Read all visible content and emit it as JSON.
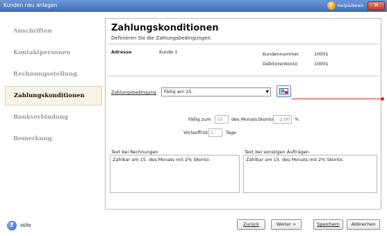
{
  "window": {
    "title": "Kunden neu anlegen",
    "help_label": "Help&News",
    "close_glyph": "✕"
  },
  "sidebar": {
    "items": [
      {
        "label": "Anschriften"
      },
      {
        "label": "Kontaktpersonen"
      },
      {
        "label": "Rechnungsstellung"
      },
      {
        "label": "Zahlungskonditionen"
      },
      {
        "label": "Bankverbindung"
      },
      {
        "label": "Bemerkung"
      }
    ],
    "active_index": 3
  },
  "header": {
    "title": "Zahlungskonditionen",
    "subtitle": "Definieren Sie die Zahlungsbedingungen."
  },
  "address": {
    "section_label": "Adresse",
    "customer": "Kunde 1",
    "customer_number_label": "Kundennummer",
    "customer_number": "10001",
    "debtor_account_label": "Debitorenkonto",
    "debtor_account": "10001"
  },
  "payment": {
    "condition_label": "Zahlungsbedingung",
    "condition_value": "Fällig am 15.",
    "due_label": "Fällig zum",
    "due_day": "15",
    "due_suffix": "des Monats",
    "discount_label": "Skonto",
    "discount_value": "2,00",
    "discount_unit": "%",
    "lead_label": "Vorlauffrist",
    "lead_days": "2",
    "lead_unit": "Tage"
  },
  "texts": {
    "invoice_label": "Text bei Rechnungen",
    "invoice_text": "Zahlbar am 15. des Monats mit 2% Skonto.",
    "orders_label": "Text bei sonstigen Aufträgen",
    "orders_text": "Zahlbar am 15. des Monats mit 2% Skonto."
  },
  "footer": {
    "help_label": "Hilfe",
    "back_label": "Zurück",
    "next_label": "Weiter >",
    "save_label": "Speichern",
    "cancel_label": "Abbrechen"
  },
  "colors": {
    "titlebar": "#3f6fbc",
    "active_nav_bg": "#f7f3e6",
    "callout": "#d8261a"
  },
  "icons": {
    "help": "help-icon",
    "close": "close-icon",
    "dropdown": "chevron-down-icon",
    "picker": "condition-picker-icon",
    "footer_help": "question-mark-icon"
  }
}
